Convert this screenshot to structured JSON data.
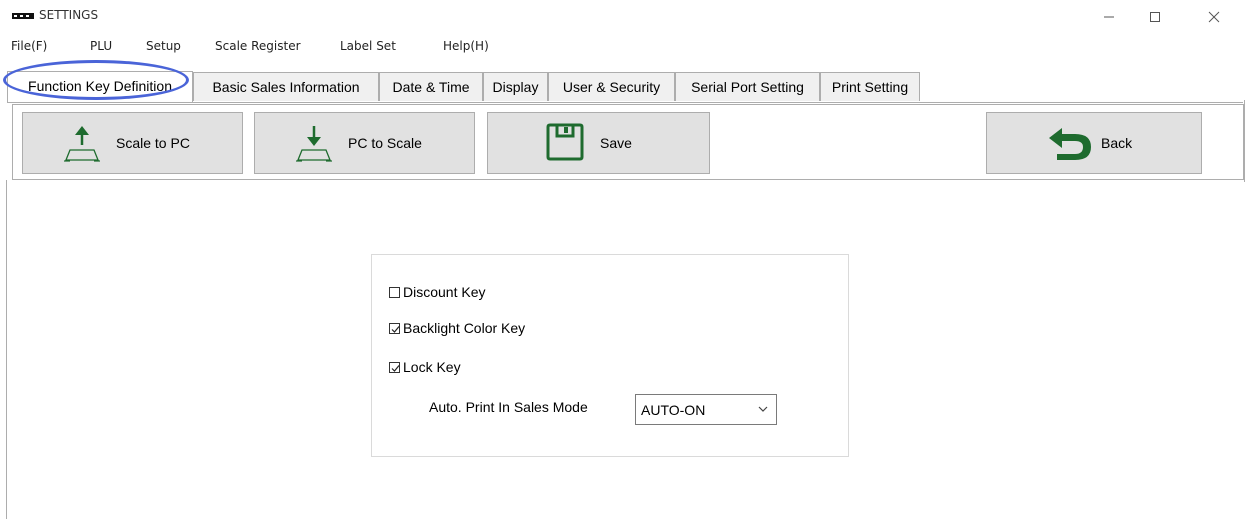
{
  "window": {
    "title": "SETTINGS",
    "logo_text": "PWR"
  },
  "menu": {
    "items": [
      "File(F)",
      "PLU",
      "Setup",
      "Scale Register",
      "Label Set",
      "Help(H)"
    ]
  },
  "tabs": {
    "items": [
      "Function Key Definition",
      "Basic Sales Information",
      "Date & Time",
      "Display",
      "User & Security",
      "Serial Port Setting",
      "Print Setting"
    ],
    "active": "Function Key Definition"
  },
  "toolbar": {
    "scale_to_pc": "Scale to PC",
    "pc_to_scale": "PC to Scale",
    "save": "Save",
    "back": "Back"
  },
  "form": {
    "discount_key": {
      "label": "Discount Key",
      "checked": false
    },
    "backlight_color_key": {
      "label": "Backlight Color Key",
      "checked": true
    },
    "lock_key": {
      "label": "Lock Key",
      "checked": true
    },
    "auto_print": {
      "label": "Auto. Print In Sales Mode",
      "value": "AUTO-ON"
    }
  },
  "colors": {
    "icon_green": "#1e6b2e",
    "highlight_ring": "#4a64d8",
    "button_bg": "#e1e1e1"
  }
}
